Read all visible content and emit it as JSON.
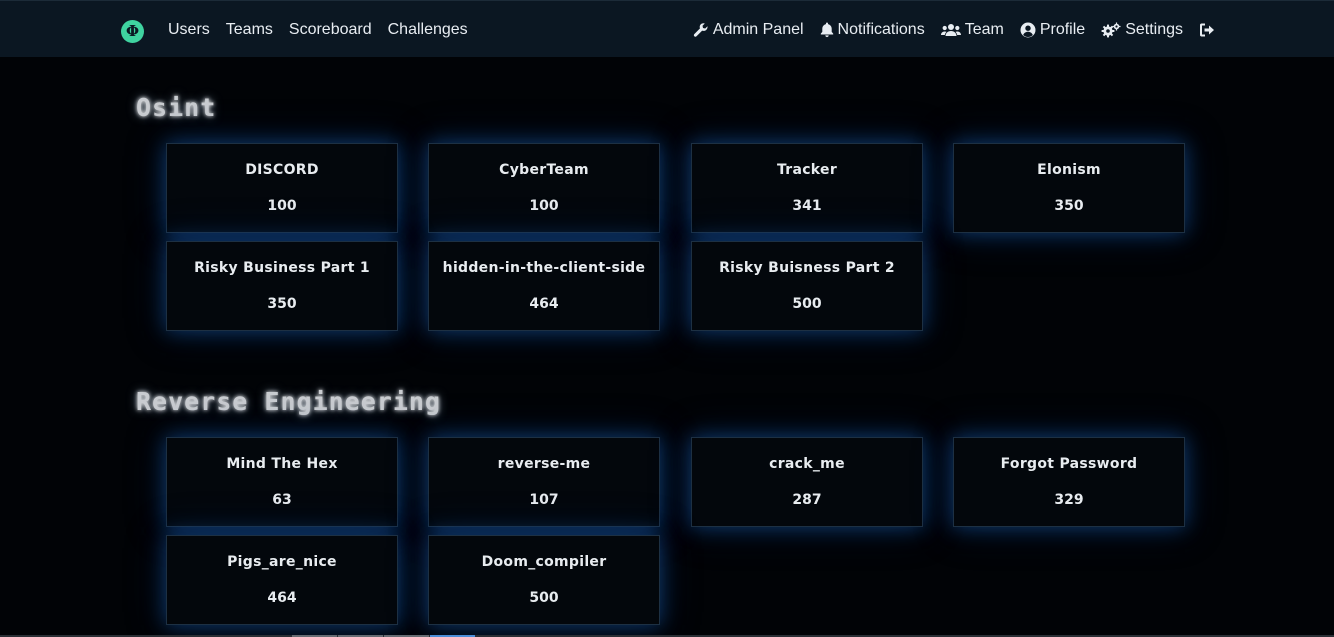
{
  "nav": {
    "logo_glyph": "Φ",
    "left_links": [
      "Users",
      "Teams",
      "Scoreboard",
      "Challenges"
    ],
    "right_items": [
      {
        "label": "Admin Panel",
        "icon": "wrench-icon"
      },
      {
        "label": "Notifications",
        "icon": "bell-icon"
      },
      {
        "label": "Team",
        "icon": "users-icon"
      },
      {
        "label": "Profile",
        "icon": "user-circle-icon"
      },
      {
        "label": "Settings",
        "icon": "gears-icon"
      },
      {
        "label": "",
        "icon": "logout-icon"
      }
    ]
  },
  "categories": [
    {
      "title": "Osint",
      "challenges": [
        {
          "name": "DISCORD",
          "value": "100"
        },
        {
          "name": "CyberTeam",
          "value": "100"
        },
        {
          "name": "Tracker",
          "value": "341"
        },
        {
          "name": "Elonism",
          "value": "350"
        },
        {
          "name": "Risky Business Part 1",
          "value": "350"
        },
        {
          "name": "hidden-in-the-client-side",
          "value": "464"
        },
        {
          "name": "Risky Buisness Part 2",
          "value": "500"
        }
      ]
    },
    {
      "title": "Reverse Engineering",
      "challenges": [
        {
          "name": "Mind The Hex",
          "value": "63"
        },
        {
          "name": "reverse-me",
          "value": "107"
        },
        {
          "name": "crack_me",
          "value": "287"
        },
        {
          "name": "Forgot Password",
          "value": "329"
        },
        {
          "name": "Pigs_are_nice",
          "value": "464"
        },
        {
          "name": "Doom_compiler",
          "value": "500"
        }
      ]
    }
  ],
  "colors": {
    "nav_bg": "#0b1722",
    "page_bg": "#010306",
    "logo": "#3fd3a0",
    "card_glow": "#195aaa"
  }
}
